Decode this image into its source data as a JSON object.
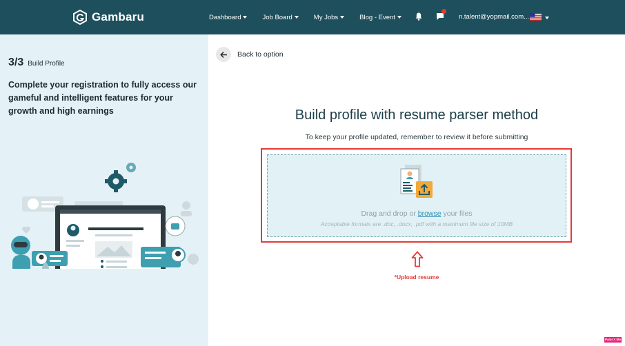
{
  "header": {
    "brand": "Gambaru",
    "nav": [
      {
        "label": "Dashboard"
      },
      {
        "label": "Job Board"
      },
      {
        "label": "My Jobs"
      },
      {
        "label": "Blog - Event"
      }
    ],
    "user_email": "n.talent@yopmail.com...",
    "icons": [
      "bell-icon",
      "chat-icon",
      "us-flag-icon"
    ],
    "brand_color": "#1e4f5c"
  },
  "sidebar": {
    "step_number": "3/3",
    "step_label": "Build Profile",
    "intro": "Complete your registration to fully access our gameful and intelligent features for your growth and high earnings",
    "background": "#e4f2f8"
  },
  "main": {
    "back_label": "Back to option",
    "title": "Build profile with resume parser method",
    "subtitle": "To keep your profile updated, remember to review it before submitting",
    "dropzone": {
      "text_before": "Drag and drop or ",
      "browse_label": "browse",
      "text_after": " your files",
      "hint": "Acceptable formats are .doc, .docx, .pdf with a maximum file size of 10MB"
    },
    "upload_note": "*Upload resume",
    "annotation_color": "#e53935"
  },
  "corner_badge": "Paint X lite"
}
